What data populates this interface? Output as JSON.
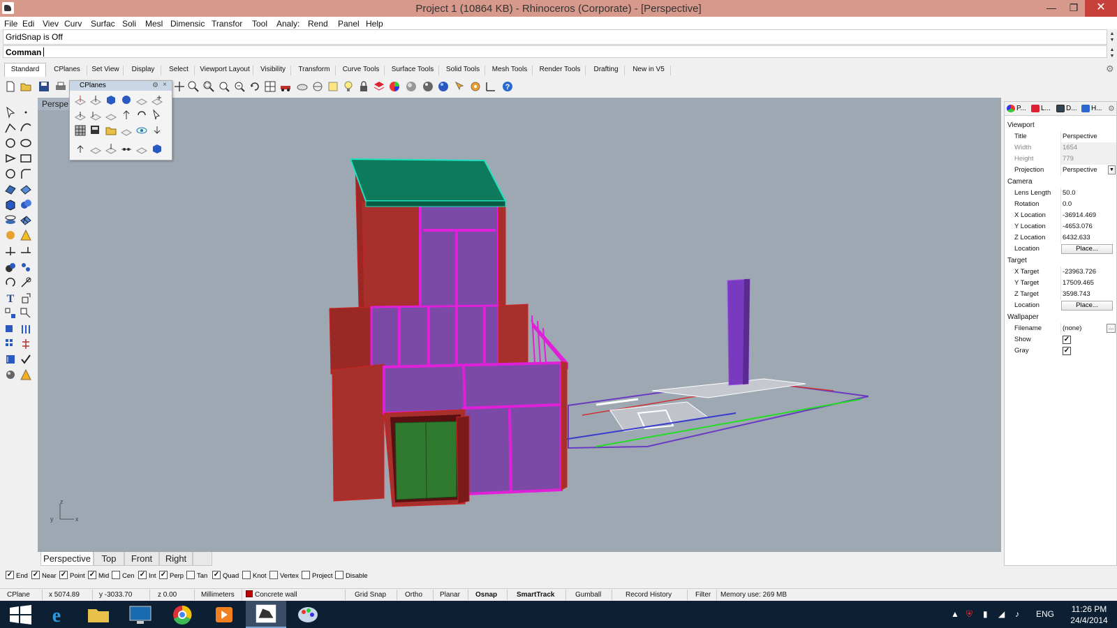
{
  "window": {
    "title": "Project 1 (10864 KB) - Rhinoceros (Corporate) - [Perspective]",
    "minimize_glyph": "—",
    "maximize_glyph": "❐",
    "close_glyph": "✕"
  },
  "menu": [
    "File",
    "Edi",
    "Viev",
    "Curv",
    "Surfac",
    "Soli",
    "Mesl",
    "Dimensic",
    "Transfor",
    "Tool",
    "Analy:",
    "Rend",
    "Panel",
    "Help"
  ],
  "command": {
    "history": "GridSnap is Off",
    "prompt": "Comman"
  },
  "toolbar_tabs": [
    "Standard",
    "CPlanes",
    "Set View",
    "Display",
    "Select",
    "Viewport Layout",
    "Visibility",
    "Transform",
    "Curve Tools",
    "Surface Tools",
    "Solid Tools",
    "Mesh Tools",
    "Render Tools",
    "Drafting",
    "New in V5"
  ],
  "cplanes_panel": {
    "title": "CPlanes",
    "gear": "⚙",
    "close": "×"
  },
  "viewport": {
    "label": "Perspe",
    "axis_z": "z",
    "axis_y": "y",
    "axis_x": "x"
  },
  "view_tabs": [
    "Perspective",
    "Top",
    "Front",
    "Right"
  ],
  "osnaps": [
    {
      "label": "End",
      "checked": true
    },
    {
      "label": "Near",
      "checked": true
    },
    {
      "label": "Point",
      "checked": true
    },
    {
      "label": "Mid",
      "checked": true
    },
    {
      "label": "Cen",
      "checked": false
    },
    {
      "label": "Int",
      "checked": true
    },
    {
      "label": "Perp",
      "checked": true
    },
    {
      "label": "Tan",
      "checked": false
    },
    {
      "label": "Quad",
      "checked": true
    },
    {
      "label": "Knot",
      "checked": false
    },
    {
      "label": "Vertex",
      "checked": false
    },
    {
      "label": "Project",
      "checked": false
    },
    {
      "label": "Disable",
      "checked": false
    }
  ],
  "status": {
    "cplane": "CPlane",
    "x": "x 5074.89",
    "y": "y -3033.70",
    "z": "z 0.00",
    "units": "Millimeters",
    "layer": "Concrete wall",
    "layer_color": "#c00000",
    "grid_snap": "Grid Snap",
    "ortho": "Ortho",
    "planar": "Planar",
    "osnap": "Osnap",
    "smarttrack": "SmartTrack",
    "gumball": "Gumball",
    "record_history": "Record History",
    "filter": "Filter",
    "memory": "Memory use: 269 MB"
  },
  "panel": {
    "tabs": [
      "P...",
      "L...",
      "D...",
      "H..."
    ],
    "sections": {
      "viewport": "Viewport",
      "camera": "Camera",
      "target": "Target",
      "wallpaper": "Wallpaper"
    },
    "title_label": "Title",
    "title_value": "Perspective",
    "width_label": "Width",
    "width_value": "1654",
    "height_label": "Height",
    "height_value": "779",
    "projection_label": "Projection",
    "projection_value": "Perspective",
    "lens_label": "Lens Length",
    "lens_value": "50.0",
    "rotation_label": "Rotation",
    "rotation_value": "0.0",
    "xloc_label": "X Location",
    "xloc_value": "-36914.469",
    "yloc_label": "Y Location",
    "yloc_value": "-4653.076",
    "zloc_label": "Z Location",
    "zloc_value": "6432.633",
    "location_label": "Location",
    "place_button": "Place...",
    "xtarget_label": "X Target",
    "xtarget_value": "-23963.726",
    "ytarget_label": "Y Target",
    "ytarget_value": "17509.465",
    "ztarget_label": "Z Target",
    "ztarget_value": "3598.743",
    "filename_label": "Filename",
    "filename_value": "(none)",
    "show_label": "Show",
    "show_checked": true,
    "gray_label": "Gray",
    "gray_checked": true
  },
  "taskbar": {
    "lang": "ENG",
    "time": "11:26 PM",
    "date": "24/4/2014"
  },
  "colors": {
    "titlebar": "#d6998c",
    "viewport_bg": "#9ea8b3",
    "wall_red": "#a8302c",
    "window_magenta": "#e020d8",
    "glass_purple": "#7a4aa6",
    "roof_green": "#0e7a5c",
    "door_green": "#2f7a2f"
  }
}
